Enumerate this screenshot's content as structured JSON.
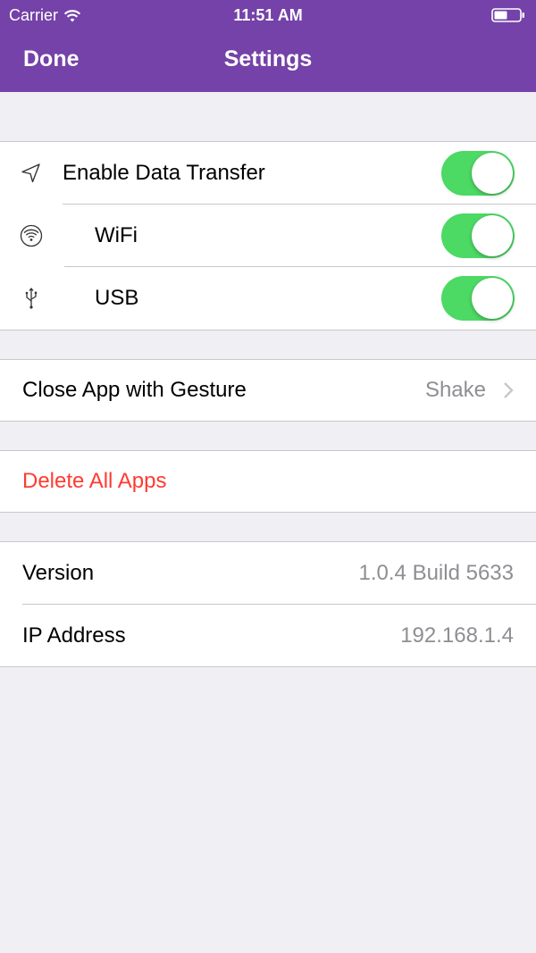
{
  "status_bar": {
    "carrier": "Carrier",
    "time": "11:51 AM"
  },
  "nav": {
    "done_label": "Done",
    "title": "Settings"
  },
  "transfer": {
    "enable": {
      "label": "Enable Data Transfer",
      "icon": "location-arrow-icon",
      "on": true
    },
    "wifi": {
      "label": "WiFi",
      "icon": "wifi-icon",
      "on": true
    },
    "usb": {
      "label": "USB",
      "icon": "usb-icon",
      "on": true
    }
  },
  "gesture": {
    "label": "Close App with Gesture",
    "value": "Shake"
  },
  "delete": {
    "label": "Delete All Apps",
    "color": "#ff3b30"
  },
  "info": {
    "version_label": "Version",
    "version_value": "1.0.4 Build 5633",
    "ip_label": "IP Address",
    "ip_value": "192.168.1.4"
  },
  "colors": {
    "accent": "#7442a8",
    "toggle_on": "#4cd964",
    "background": "#efeff4"
  }
}
